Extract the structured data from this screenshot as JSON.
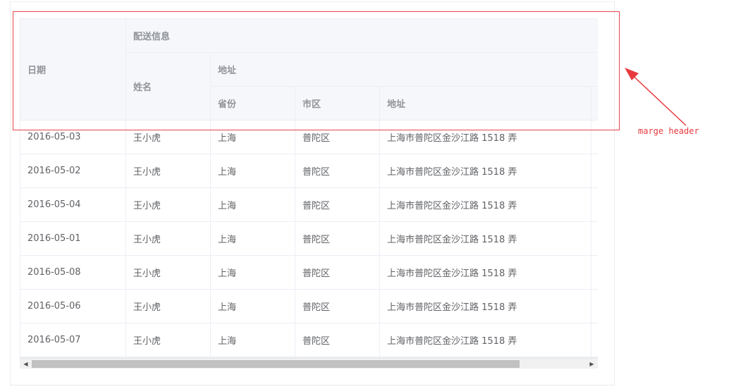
{
  "table": {
    "headers": {
      "date": "日期",
      "delivery_info": "配送信息",
      "name": "姓名",
      "address_group": "地址",
      "province": "省份",
      "city": "市区",
      "address": "地址"
    },
    "rows": [
      {
        "date": "2016-05-03",
        "name": "王小虎",
        "province": "上海",
        "city": "普陀区",
        "address": "上海市普陀区金沙江路 1518 弄"
      },
      {
        "date": "2016-05-02",
        "name": "王小虎",
        "province": "上海",
        "city": "普陀区",
        "address": "上海市普陀区金沙江路 1518 弄"
      },
      {
        "date": "2016-05-04",
        "name": "王小虎",
        "province": "上海",
        "city": "普陀区",
        "address": "上海市普陀区金沙江路 1518 弄"
      },
      {
        "date": "2016-05-01",
        "name": "王小虎",
        "province": "上海",
        "city": "普陀区",
        "address": "上海市普陀区金沙江路 1518 弄"
      },
      {
        "date": "2016-05-08",
        "name": "王小虎",
        "province": "上海",
        "city": "普陀区",
        "address": "上海市普陀区金沙江路 1518 弄"
      },
      {
        "date": "2016-05-06",
        "name": "王小虎",
        "province": "上海",
        "city": "普陀区",
        "address": "上海市普陀区金沙江路 1518 弄"
      },
      {
        "date": "2016-05-07",
        "name": "王小虎",
        "province": "上海",
        "city": "普陀区",
        "address": "上海市普陀区金沙江路 1518 弄"
      }
    ]
  },
  "scrollbar": {
    "left_icon": "scroll-left-arrow-icon",
    "right_icon": "scroll-right-arrow-icon",
    "position": 0
  },
  "annotation": {
    "text": "marge header",
    "color": "#e8393f"
  },
  "colors": {
    "header_bg": "#f5f7fa",
    "header_text": "#909399",
    "body_text": "#606266",
    "border": "#ebeef5",
    "highlight": "#e8454a"
  }
}
